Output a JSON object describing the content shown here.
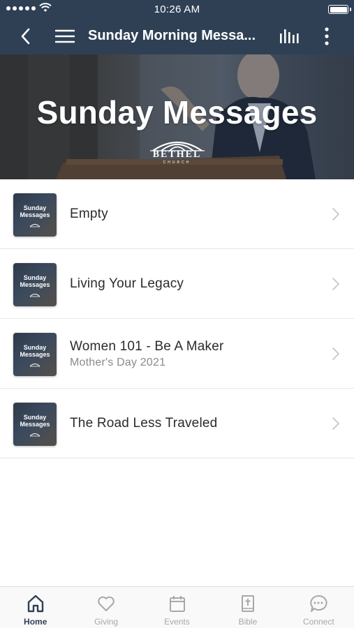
{
  "status_bar": {
    "time": "10:26 AM"
  },
  "nav": {
    "title": "Sunday Morning Messa...",
    "icons": [
      "back-chevron-icon",
      "hamburger-menu-icon",
      "audio-bars-icon",
      "more-vertical-icon"
    ]
  },
  "hero": {
    "title": "Sunday Messages",
    "logo_text": "BETHEL",
    "logo_subtext": "CHURCH"
  },
  "thumbnail": {
    "line1": "Sunday",
    "line2": "Messages"
  },
  "messages": [
    {
      "title": "Empty",
      "subtitle": ""
    },
    {
      "title": "Living Your Legacy",
      "subtitle": ""
    },
    {
      "title": "Women 101 - Be A Maker",
      "subtitle": "Mother's Day 2021"
    },
    {
      "title": "The Road Less Traveled",
      "subtitle": ""
    }
  ],
  "tabs": [
    {
      "label": "Home",
      "icon": "home-icon",
      "active": true
    },
    {
      "label": "Giving",
      "icon": "heart-icon",
      "active": false
    },
    {
      "label": "Events",
      "icon": "calendar-icon",
      "active": false
    },
    {
      "label": "Bible",
      "icon": "bible-icon",
      "active": false
    },
    {
      "label": "Connect",
      "icon": "chat-bubble-icon",
      "active": false
    }
  ],
  "colors": {
    "header_background": "#2f4055",
    "active_tab": "#2f4055",
    "inactive_tab": "#a8a8a8",
    "subtitle": "#8a8a8a"
  }
}
